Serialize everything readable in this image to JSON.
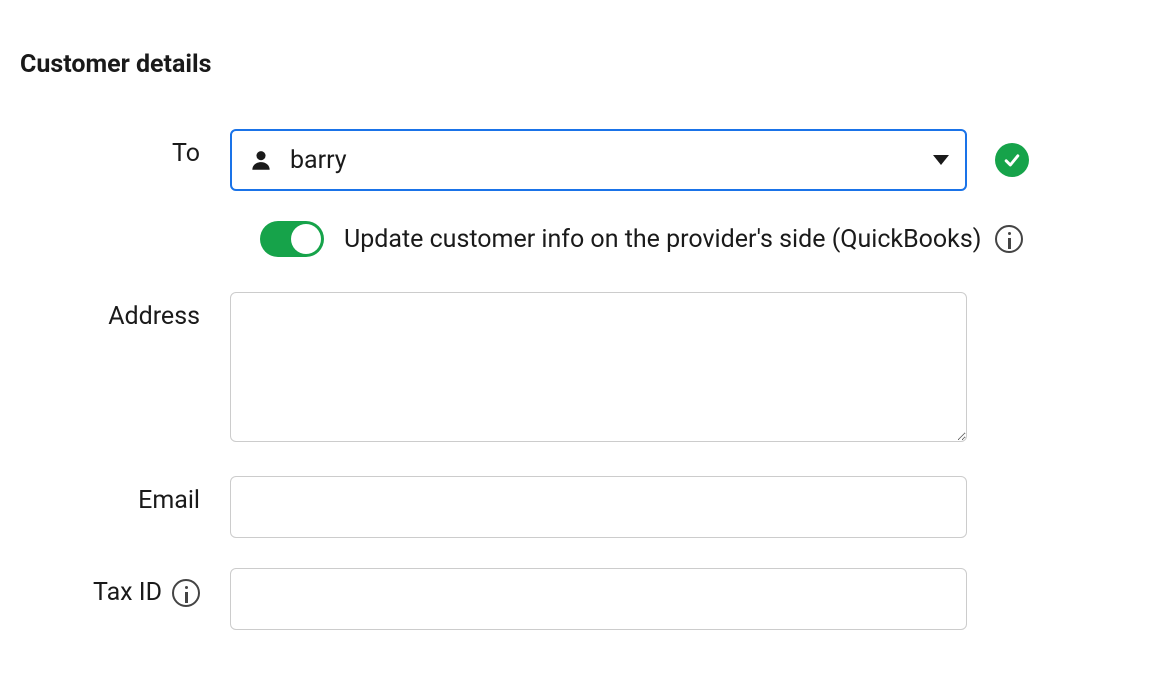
{
  "section": {
    "title": "Customer details"
  },
  "fields": {
    "to": {
      "label": "To",
      "value": "barry"
    },
    "toggle": {
      "label": "Update customer info on the provider's side (QuickBooks)",
      "enabled": true
    },
    "address": {
      "label": "Address",
      "value": ""
    },
    "email": {
      "label": "Email",
      "value": ""
    },
    "taxid": {
      "label": "Tax ID",
      "value": ""
    }
  }
}
